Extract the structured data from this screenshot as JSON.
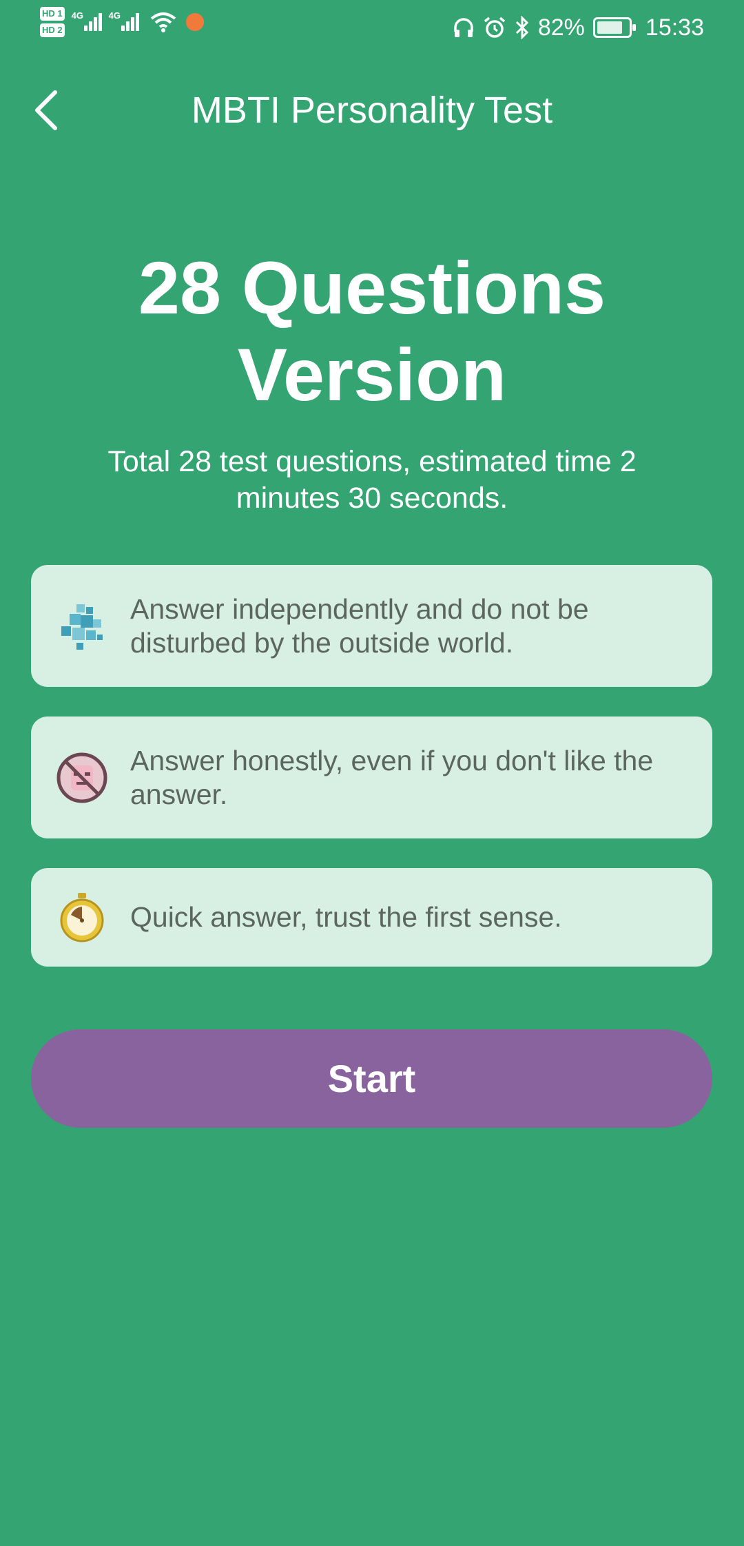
{
  "status_bar": {
    "sim1_label": "HD 1",
    "sim2_label": "HD 2",
    "network_1": "4G",
    "network_2": "4G",
    "battery_percent": "82%",
    "battery_level": 0.82,
    "time": "15:33",
    "icons": [
      "wifi-icon",
      "app-notification-icon",
      "headphones-icon",
      "alarm-icon",
      "bluetooth-icon",
      "battery-charging-icon"
    ]
  },
  "header": {
    "title": "MBTI Personality Test",
    "back_icon": "chevron-left-icon"
  },
  "hero": {
    "title": "28 Questions Version",
    "subtitle": "Total 28 test questions, estimated time 2 minutes 30 seconds."
  },
  "tips": [
    {
      "icon": "blocks-icon",
      "text": "Answer independently and do not be disturbed by the outside world."
    },
    {
      "icon": "no-face-icon",
      "text": "Answer honestly, even if you don't like the answer."
    },
    {
      "icon": "stopwatch-icon",
      "text": "Quick answer, trust the first sense."
    }
  ],
  "start_button": {
    "label": "Start"
  },
  "colors": {
    "background": "#34a572",
    "card": "#d8efe3",
    "card_text": "#5c6661",
    "start_button": "#88639d",
    "text": "#ffffff"
  }
}
